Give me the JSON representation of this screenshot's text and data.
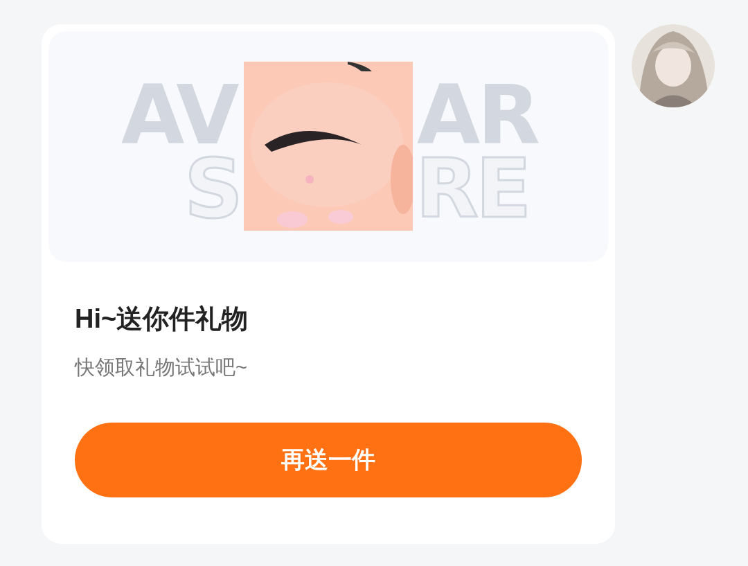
{
  "banner": {
    "background_text": [
      "AV",
      "AR",
      "S",
      "RE"
    ]
  },
  "title": "Hi~送你件礼物",
  "subtitle": "快领取礼物试试吧~",
  "button": {
    "label": "再送一件"
  }
}
